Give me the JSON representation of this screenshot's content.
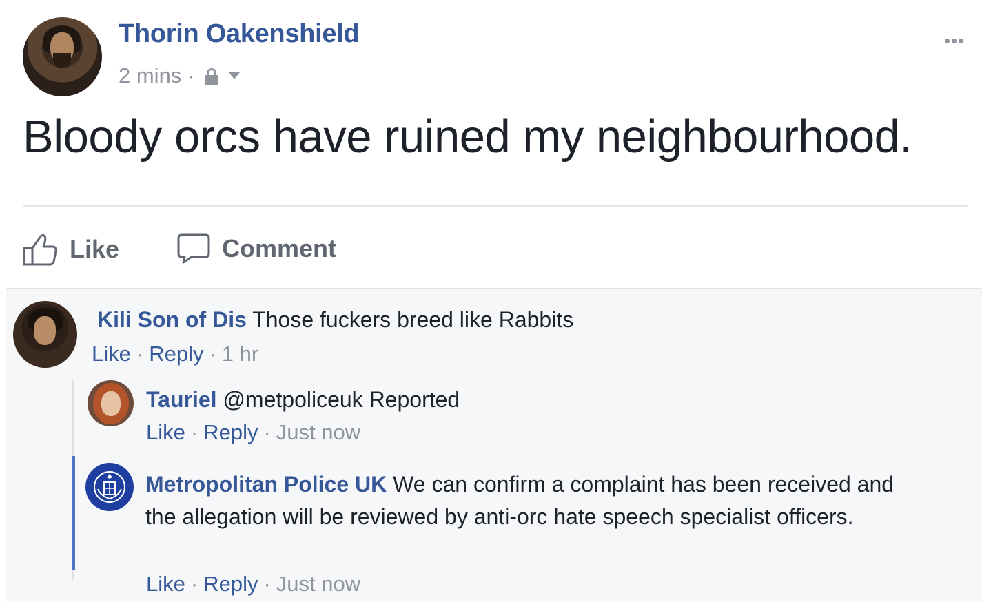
{
  "post": {
    "author": "Thorin Oakenshield",
    "time": "2 mins",
    "separator": "·",
    "text": "Bloody orcs have ruined my neighbourhood.",
    "more_label": "•••",
    "actions": {
      "like": "Like",
      "comment": "Comment"
    }
  },
  "comments": [
    {
      "author": "Kili Son of Dis",
      "text": "Those fuckers breed like Rabbits",
      "like": "Like",
      "reply": "Reply",
      "time": "1 hr"
    },
    {
      "author": "Tauriel",
      "text": "@metpoliceuk Reported",
      "like": "Like",
      "reply": "Reply",
      "time": "Just now"
    },
    {
      "author": "Metropolitan Police UK",
      "text": "We can confirm a complaint has been received and the allegation will be reviewed by anti-orc hate speech specialist officers.",
      "like": "Like",
      "reply": "Reply",
      "time": "Just now"
    }
  ],
  "colors": {
    "link_blue": "#365899",
    "muted_gray": "#90949c",
    "text_dark": "#1d2129",
    "comment_bg": "#f6f7f9",
    "thread_highlight": "#4a76c4"
  },
  "icons": {
    "privacy": "lock-icon",
    "audience_menu": "caret-down-icon",
    "like": "thumbs-up-icon",
    "comment": "speech-bubble-icon"
  }
}
